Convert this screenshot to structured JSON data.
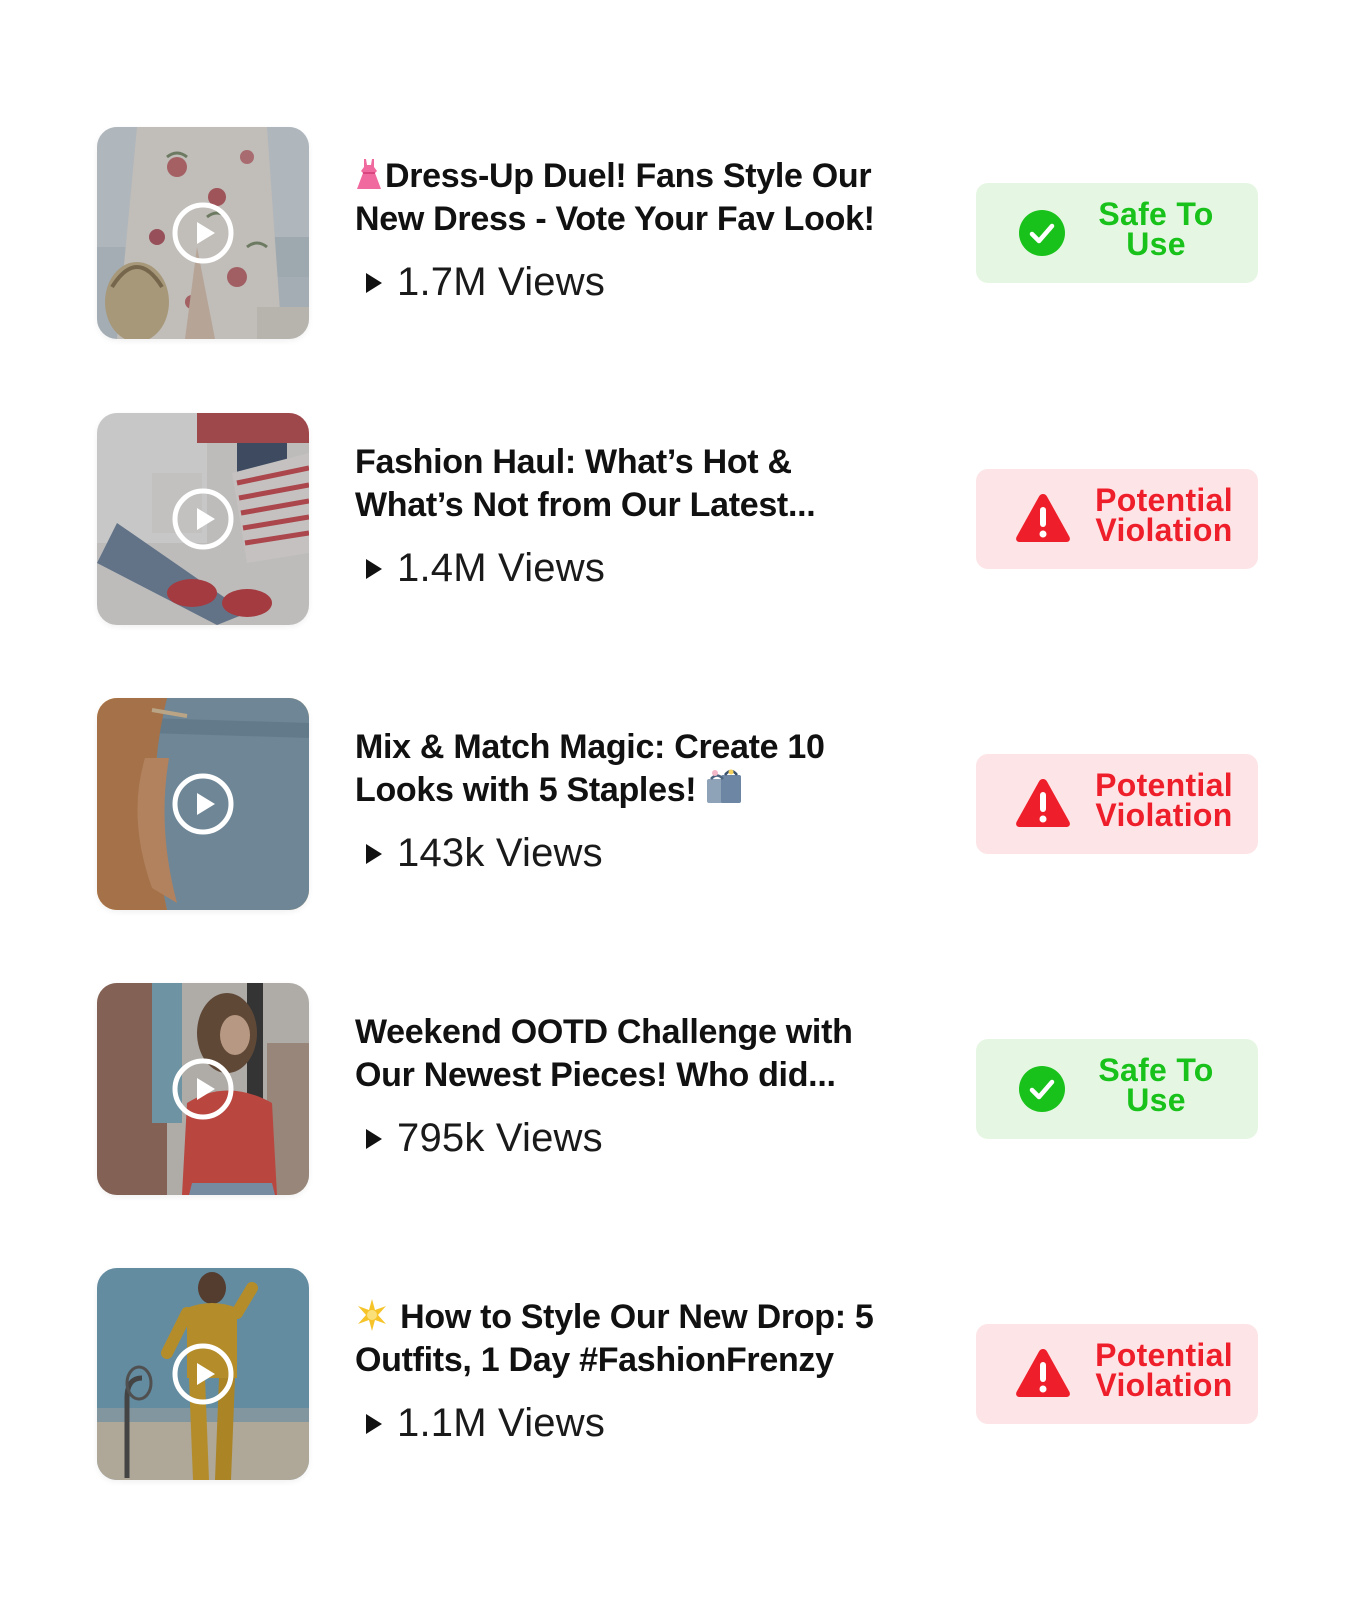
{
  "colors": {
    "safe_bg": "#e5f7e3",
    "safe_text": "#19c21a",
    "violation_bg": "#fde4e6",
    "violation_text": "#ee1f2a",
    "title_text": "#111111"
  },
  "videos": [
    {
      "title_line1": "Dress-Up Duel! Fans Style Our",
      "title_line2": "New Dress - Vote Your Fav Look!",
      "title_emoji": "dress-emoji",
      "views": "1.7M Views",
      "status": {
        "kind": "safe",
        "line1": "Safe To",
        "line2": "Use",
        "icon": "check-circle-icon"
      }
    },
    {
      "title_line1": "Fashion Haul: What’s Hot &",
      "title_line2": "What’s Not from Our Latest...",
      "views": "1.4M Views",
      "status": {
        "kind": "violation",
        "line1": "Potential",
        "line2": "Violation",
        "icon": "warning-triangle-icon"
      }
    },
    {
      "title_line1": "Mix & Match Magic: Create 10",
      "title_line2": "Looks with 5 Staples!",
      "title_emoji": "shopping-bags-emoji",
      "views": "143k Views",
      "status": {
        "kind": "violation",
        "line1": "Potential",
        "line2": "Violation",
        "icon": "warning-triangle-icon"
      }
    },
    {
      "title_line1": "Weekend OOTD Challenge with",
      "title_line2": "Our Newest Pieces! Who did...",
      "views": "795k Views",
      "status": {
        "kind": "safe",
        "line1": "Safe To",
        "line2": "Use",
        "icon": "check-circle-icon"
      }
    },
    {
      "title_line1": "How to Style Our New Drop: 5",
      "title_line2": "Outfits, 1 Day #FashionFrenzy",
      "title_emoji": "sparkle-emoji",
      "views": "1.1M Views",
      "status": {
        "kind": "violation",
        "line1": "Potential",
        "line2": "Violation",
        "icon": "warning-triangle-icon"
      }
    }
  ]
}
